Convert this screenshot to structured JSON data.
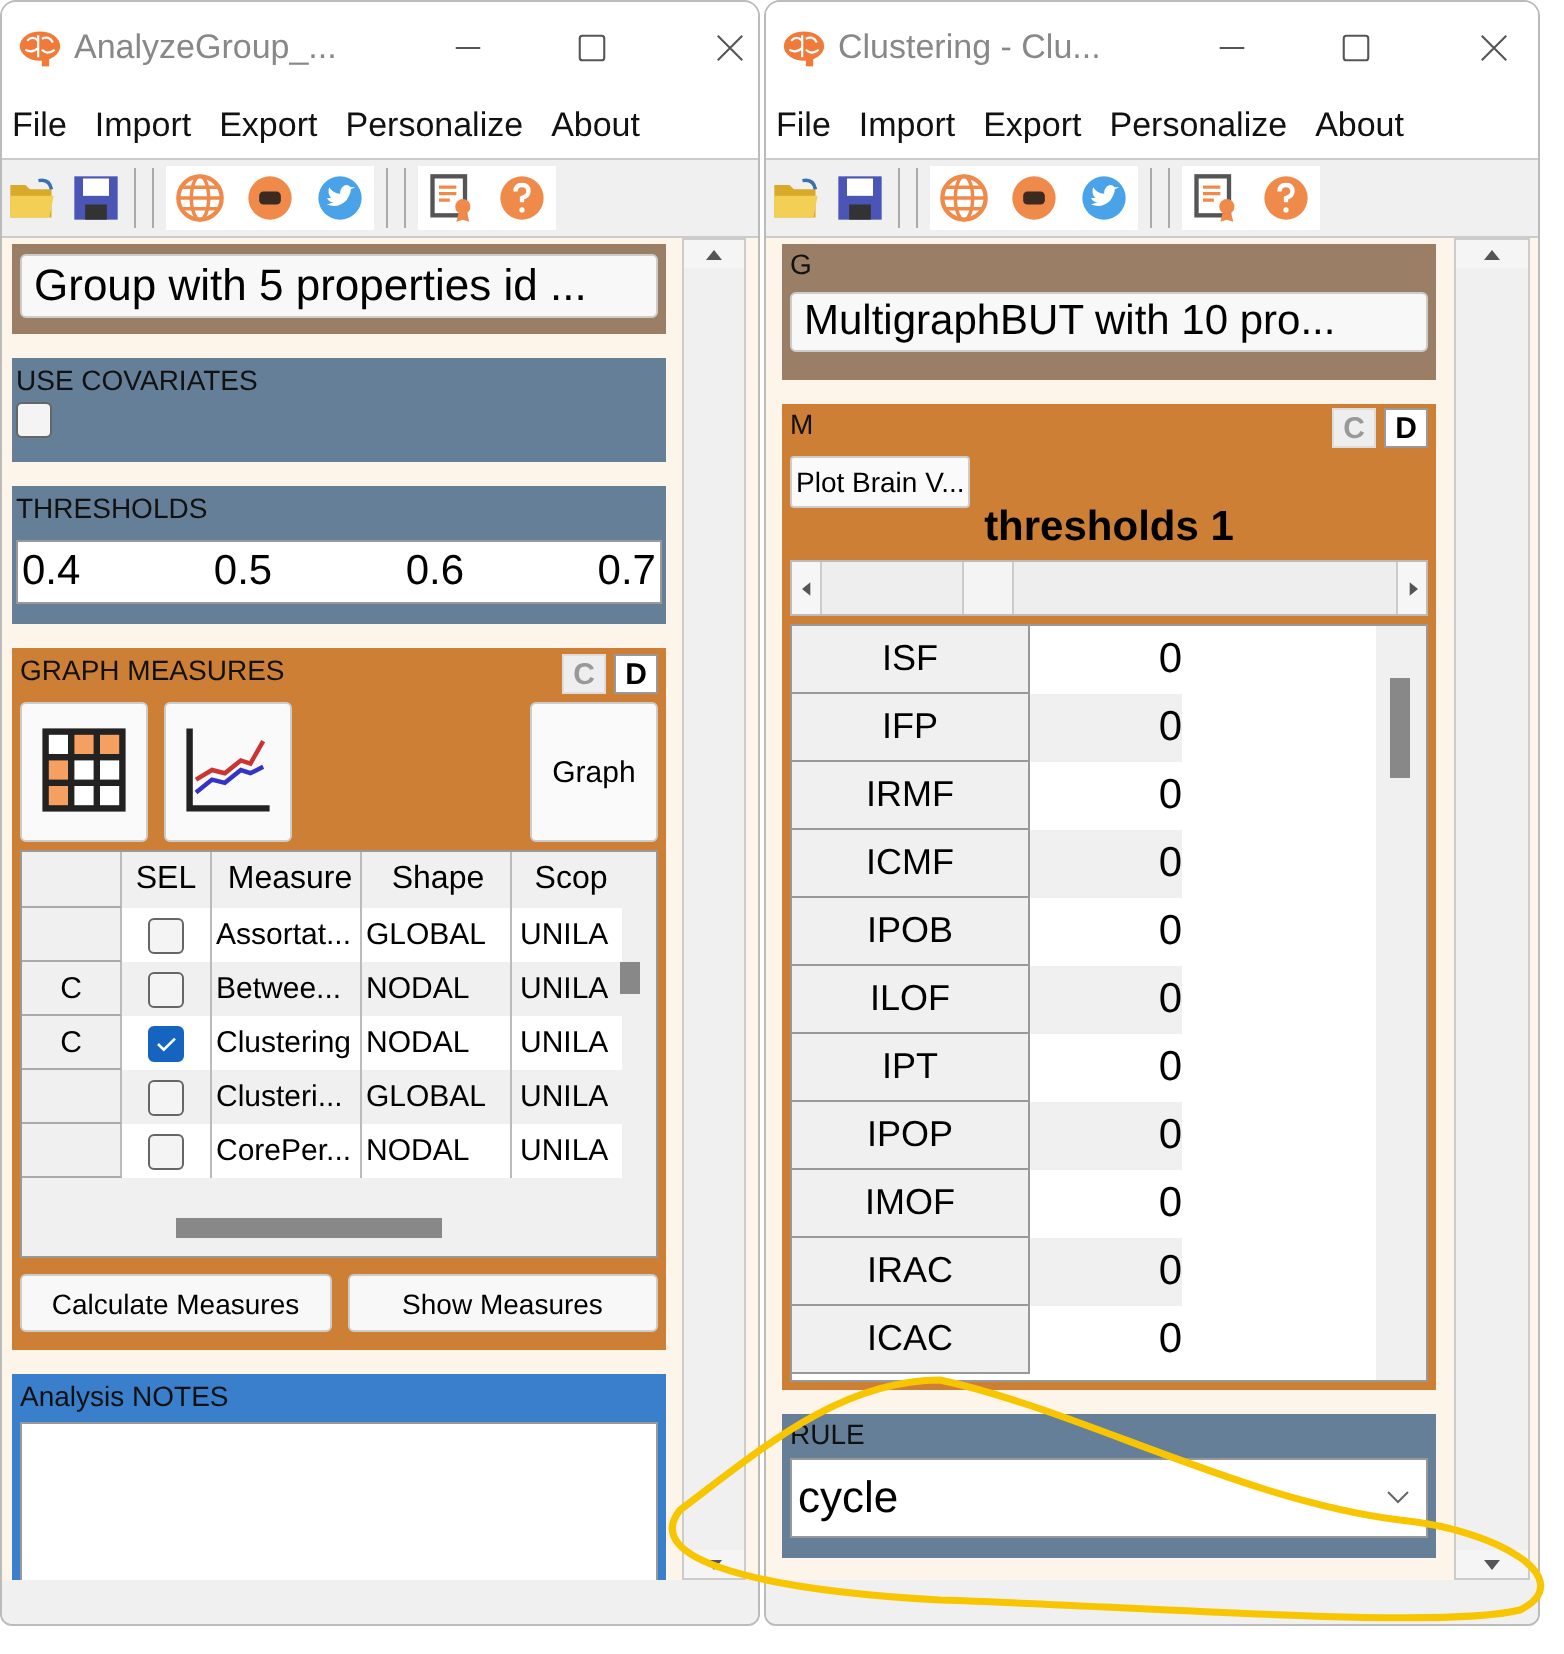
{
  "windows": [
    {
      "kind": "analyze_group",
      "title": "AnalyzeGroup_...",
      "menu": [
        "File",
        "Import",
        "Export",
        "Personalize",
        "About"
      ],
      "group_button": "Group with 5 properties id ...",
      "covariates": {
        "label": "USE COVARIATES",
        "checked": false
      },
      "thresholds": {
        "label": "THRESHOLDS",
        "values": [
          "0.4",
          "0.5",
          "0.6",
          "0.7"
        ]
      },
      "measures": {
        "label": "GRAPH MEASURES",
        "toggles": [
          {
            "label": "C",
            "disabled": true
          },
          {
            "label": "D",
            "disabled": false
          }
        ],
        "graph_button": "Graph",
        "columns": [
          "SEL",
          "Measure",
          "Shape",
          "Scop"
        ],
        "rows": [
          {
            "row_header": "",
            "checked": false,
            "measure": "Assortat...",
            "shape": "GLOBAL",
            "scope": "UNILA"
          },
          {
            "row_header": "C",
            "checked": false,
            "measure": "Betwee...",
            "shape": "NODAL",
            "scope": "UNILA"
          },
          {
            "row_header": "C",
            "checked": true,
            "measure": "Clustering",
            "shape": "NODAL",
            "scope": "UNILA"
          },
          {
            "row_header": "",
            "checked": false,
            "measure": "Clusteri...",
            "shape": "GLOBAL",
            "scope": "UNILA"
          },
          {
            "row_header": "",
            "checked": false,
            "measure": "CorePer...",
            "shape": "NODAL",
            "scope": "UNILA"
          }
        ],
        "buttons": [
          "Calculate Measures",
          "Show Measures"
        ]
      },
      "notes": {
        "label": "Analysis NOTES"
      }
    },
    {
      "kind": "clustering",
      "title": "Clustering - Clu...",
      "menu": [
        "File",
        "Import",
        "Export",
        "Personalize",
        "About"
      ],
      "g_label": "G",
      "g_button": "MultigraphBUT with 10 pro...",
      "m_label": "M",
      "toggles": [
        {
          "label": "C",
          "disabled": true
        },
        {
          "label": "D",
          "disabled": false
        }
      ],
      "plot_button": "Plot Brain V...",
      "slider": {
        "title": "thresholds 1",
        "level": 0.27
      },
      "values": [
        {
          "label": "ISF",
          "value": "0"
        },
        {
          "label": "IFP",
          "value": "0"
        },
        {
          "label": "IRMF",
          "value": "0"
        },
        {
          "label": "ICMF",
          "value": "0"
        },
        {
          "label": "IPOB",
          "value": "0"
        },
        {
          "label": "ILOF",
          "value": "0"
        },
        {
          "label": "IPT",
          "value": "0"
        },
        {
          "label": "IPOP",
          "value": "0"
        },
        {
          "label": "IMOF",
          "value": "0"
        },
        {
          "label": "IRAC",
          "value": "0"
        },
        {
          "label": "ICAC",
          "value": "0"
        }
      ],
      "rule": {
        "label": "RULE",
        "value": "cycle"
      }
    }
  ]
}
